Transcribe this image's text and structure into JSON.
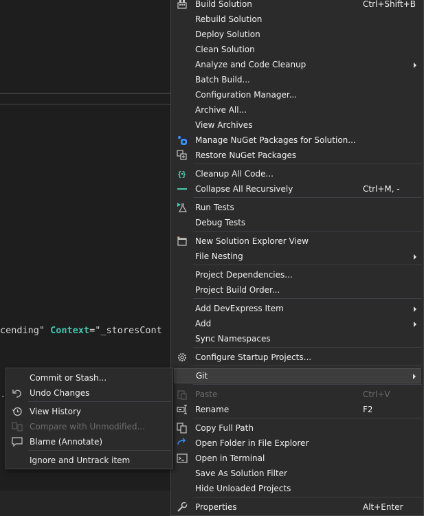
{
  "background": {
    "code_fragment_string": "cending\" ",
    "code_fragment_attr": "Context",
    "code_fragment_rest": "=\"_storesCont",
    "cut_off_mark": "."
  },
  "menu": {
    "items": [
      {
        "label": "Build Solution",
        "shortcut": "Ctrl+Shift+B",
        "icon": "build-icon"
      },
      {
        "label": "Rebuild Solution"
      },
      {
        "label": "Deploy Solution"
      },
      {
        "label": "Clean Solution"
      },
      {
        "label": "Analyze and Code Cleanup",
        "submenu": true
      },
      {
        "label": "Batch Build..."
      },
      {
        "label": "Configuration Manager..."
      },
      {
        "label": "Archive All..."
      },
      {
        "label": "View Archives"
      },
      {
        "label": "Manage NuGet Packages for Solution...",
        "icon": "nuget-icon"
      },
      {
        "label": "Restore NuGet Packages",
        "icon": "restore-packages-icon"
      },
      {
        "label": "Cleanup All Code...",
        "icon": "cleanup-code-icon"
      },
      {
        "label": "Collapse All Recursively",
        "shortcut": "Ctrl+M, -",
        "icon": "collapse-icon"
      },
      {
        "label": "Run Tests",
        "icon": "run-tests-icon"
      },
      {
        "label": "Debug Tests"
      },
      {
        "label": "New Solution Explorer View",
        "icon": "new-view-icon"
      },
      {
        "label": "File Nesting",
        "submenu": true
      },
      {
        "label": "Project Dependencies..."
      },
      {
        "label": "Project Build Order..."
      },
      {
        "label": "Add DevExpress Item",
        "submenu": true
      },
      {
        "label": "Add",
        "submenu": true
      },
      {
        "label": "Sync Namespaces"
      },
      {
        "label": "Configure Startup Projects...",
        "icon": "gear-icon"
      },
      {
        "label": "Git",
        "submenu": true,
        "highlighted": true
      },
      {
        "label": "Paste",
        "shortcut": "Ctrl+V",
        "disabled": true,
        "icon": "paste-icon"
      },
      {
        "label": "Rename",
        "shortcut": "F2",
        "icon": "rename-icon"
      },
      {
        "label": "Copy Full Path",
        "icon": "copy-icon"
      },
      {
        "label": "Open Folder in File Explorer",
        "icon": "open-folder-icon"
      },
      {
        "label": "Open in Terminal",
        "icon": "terminal-icon"
      },
      {
        "label": "Save As Solution Filter"
      },
      {
        "label": "Hide Unloaded Projects"
      },
      {
        "label": "Properties",
        "shortcut": "Alt+Enter",
        "icon": "wrench-icon"
      }
    ]
  },
  "git_submenu": {
    "items": [
      {
        "label": "Commit or Stash..."
      },
      {
        "label": "Undo Changes",
        "icon": "undo-icon"
      },
      {
        "label": "View History",
        "icon": "history-icon"
      },
      {
        "label": "Compare with Unmodified...",
        "disabled": true,
        "icon": "compare-icon"
      },
      {
        "label": "Blame (Annotate)",
        "icon": "blame-icon"
      },
      {
        "label": "Ignore and Untrack item"
      }
    ]
  },
  "colors": {
    "menu_bg": "#2b2b2b",
    "menu_border": "#454545",
    "text": "#f1f1f1",
    "disabled_text": "#6d6d6d",
    "highlight_bg": "#3d3d3d",
    "accent_blue": "#3794ff",
    "accent_teal": "#3ec9b0"
  }
}
